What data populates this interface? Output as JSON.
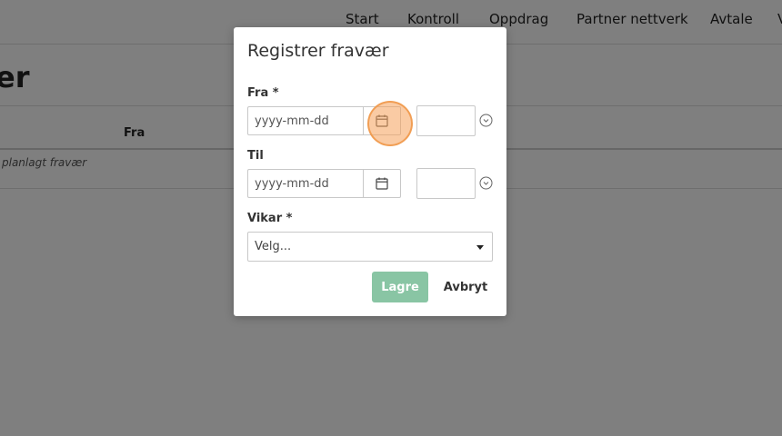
{
  "nav": {
    "items": [
      "Start",
      "Kontroll",
      "Oppdrag",
      "Partner nettverk",
      "Avtale",
      "V"
    ]
  },
  "background": {
    "page_title": "er",
    "table_column_fra": "Fra",
    "empty_text": "planlagt fravær"
  },
  "modal": {
    "title": "Registrer fravær",
    "fra_label": "Fra *",
    "til_label": "Til",
    "vikar_label": "Vikar *",
    "date_placeholder": "yyyy-mm-dd",
    "fra_time_value": "",
    "til_time_value": "",
    "vikar_selected": "Velg...",
    "save_label": "Lagre",
    "cancel_label": "Avbryt"
  },
  "colors": {
    "save_button": "#89c5a4",
    "overlay": "rgba(0,0,0,0.5)",
    "click_indicator": "#f5a05a"
  },
  "icons": {
    "calendar": "calendar-icon",
    "clock": "clock-icon",
    "caret": "caret-down-icon"
  }
}
